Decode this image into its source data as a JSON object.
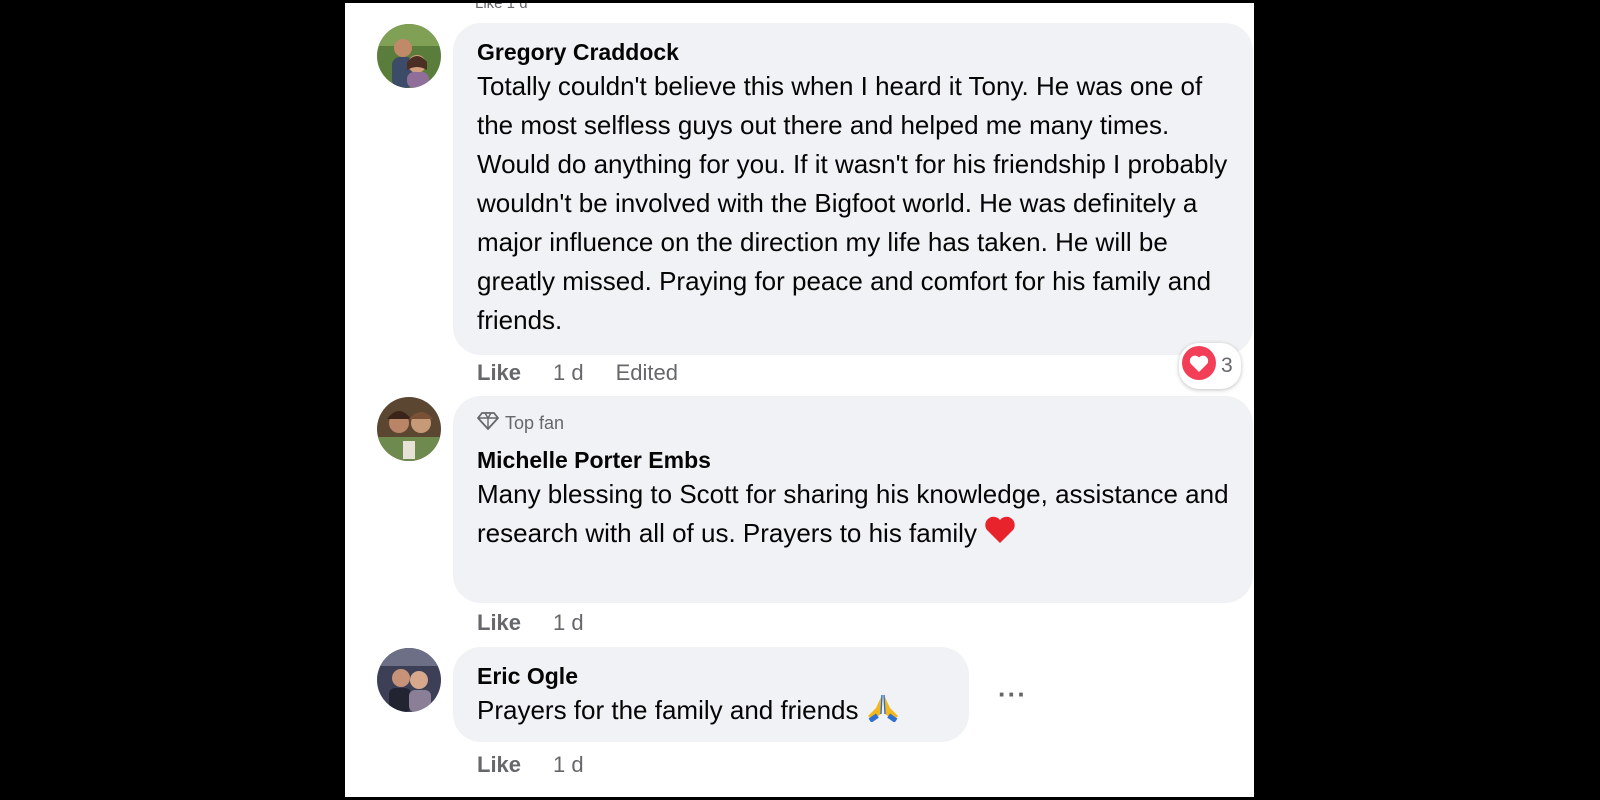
{
  "top_stub": "Like   1 d",
  "comments": [
    {
      "author": "Gregory Craddock",
      "text": "Totally couldn't believe this when I heard it Tony. He was one of the most selfless guys out there and helped me many times. Would do anything for you. If it wasn't for his friendship I probably wouldn't be involved with the Bigfoot world. He was definitely a major influence on the direction my life has taken. He will be greatly missed. Praying for peace and comfort for his family and friends.",
      "like": "Like",
      "time": "1 d",
      "edited": "Edited",
      "reaction_count": "3"
    },
    {
      "badge": "Top fan",
      "author": "Michelle Porter Embs",
      "text": "Many blessing to Scott for sharing his knowledge, assistance and research with all of us. Prayers to his family",
      "like": "Like",
      "time": "1 d"
    },
    {
      "author": "Eric Ogle",
      "text": "Prayers for the family and friends",
      "like": "Like",
      "time": "1 d",
      "more": "···"
    }
  ],
  "icons": {
    "heart_reaction": "heart-reaction-icon",
    "top_fan": "diamond-icon",
    "red_heart_emoji": "red-heart-emoji",
    "praying_hands_emoji": "praying-hands-emoji",
    "more": "more-options-icon"
  },
  "colors": {
    "bubble": "#f0f2f5",
    "heart": "#f33e58",
    "meta_text": "#65676b"
  }
}
